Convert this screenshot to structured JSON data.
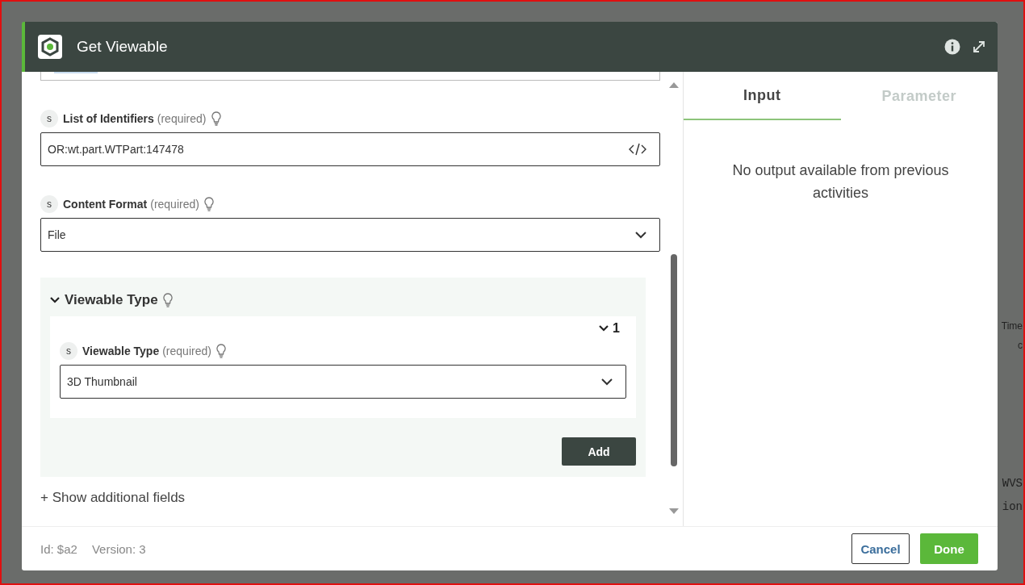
{
  "window": {
    "title": "Get Viewable"
  },
  "fields": [
    {
      "badge": "s",
      "label": "List of Identifiers",
      "note": "(required)",
      "value": "OR:wt.part.WTPart:147478",
      "kind": "code"
    },
    {
      "badge": "s",
      "label": "Content Format",
      "note": "(required)",
      "value": "File",
      "kind": "select"
    }
  ],
  "group": {
    "title": "Viewable Type",
    "expanded": true,
    "items": [
      {
        "index": "1",
        "expanded": true,
        "field": {
          "badge": "s",
          "label": "Viewable Type",
          "note": "(required)",
          "value": "3D Thumbnail",
          "kind": "select"
        }
      }
    ],
    "add_button": "Add"
  },
  "show_more": {
    "icon": "+",
    "label": "Show additional fields"
  },
  "footer": {
    "id": "Id: $a2",
    "version": "Version: 3",
    "buttons": [
      {
        "label": "Cancel",
        "kind": "secondary"
      },
      {
        "label": "Done",
        "kind": "primary"
      }
    ]
  },
  "tabs": [
    {
      "label": "Input",
      "selected": true
    },
    {
      "label": "Parameter",
      "selected": false
    }
  ],
  "message": "No output available from previous activities",
  "background": [
    {
      "text": "Time",
      "kind": "header"
    },
    {
      "text": "c",
      "kind": "header"
    },
    {
      "text": "WVS",
      "kind": "code"
    },
    {
      "text": "ion",
      "kind": "code"
    }
  ]
}
